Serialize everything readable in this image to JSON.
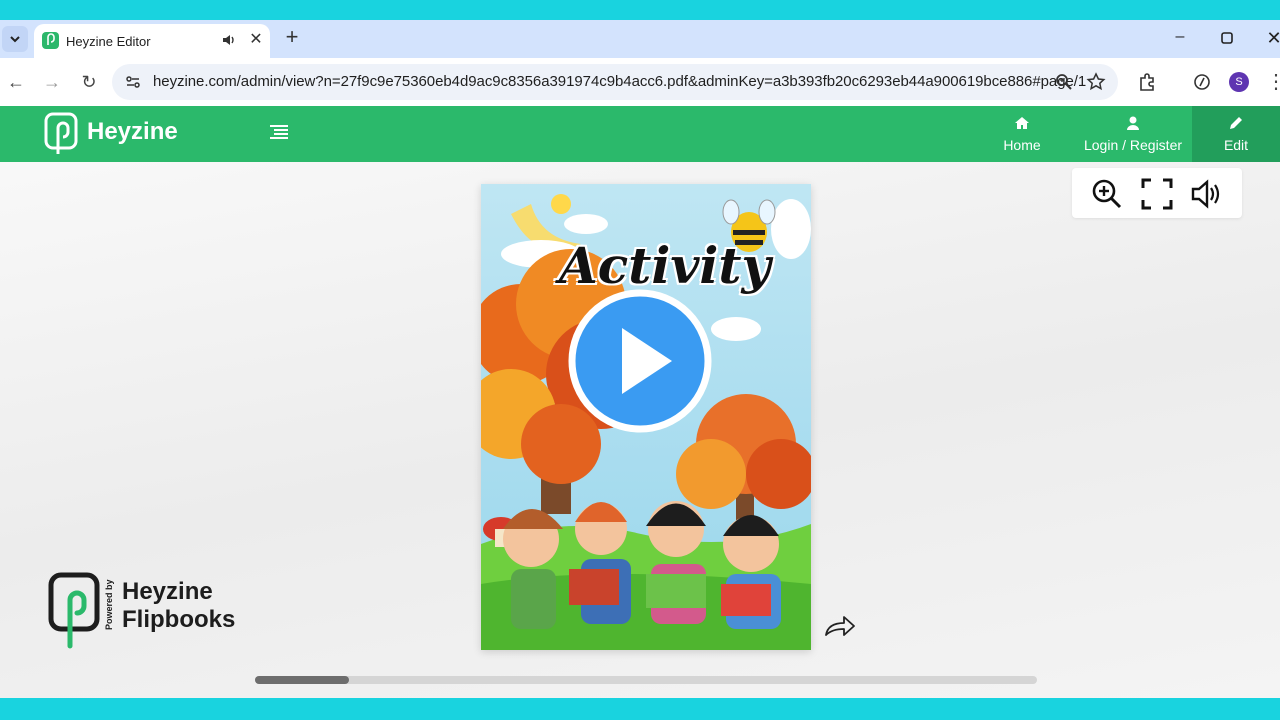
{
  "browser": {
    "tab_title": "Heyzine Editor",
    "url": "heyzine.com/admin/view?n=27f9c9e75360eb4d9ac9c8356a391974c9b4acc6.pdf&adminKey=a3b393fb20c6293eb44a900619bce886#page/1",
    "profile_initial": "S",
    "icons": [
      "tab-list-icon",
      "speaker-icon",
      "close-icon",
      "plus-icon",
      "minimize-icon",
      "maximize-icon",
      "back-icon",
      "forward-icon",
      "reload-icon",
      "site-info-icon",
      "zoom-icon",
      "star-icon",
      "extensions-icon",
      "performance-icon",
      "kebab-menu-icon"
    ]
  },
  "app": {
    "brand": "Heyzine",
    "nav": {
      "home": "Home",
      "login": "Login / Register",
      "edit": "Edit"
    },
    "cover": {
      "title": "Activity"
    },
    "powered": {
      "by": "Powered by",
      "line1": "Heyzine",
      "line2": "Flipbooks"
    },
    "scroll_position": 0.12,
    "colors": {
      "brand_green": "#2bb96b",
      "edit_green": "#229e5b",
      "play_blue": "#3a9bf2",
      "accent_cyan": "#19d3df"
    }
  }
}
